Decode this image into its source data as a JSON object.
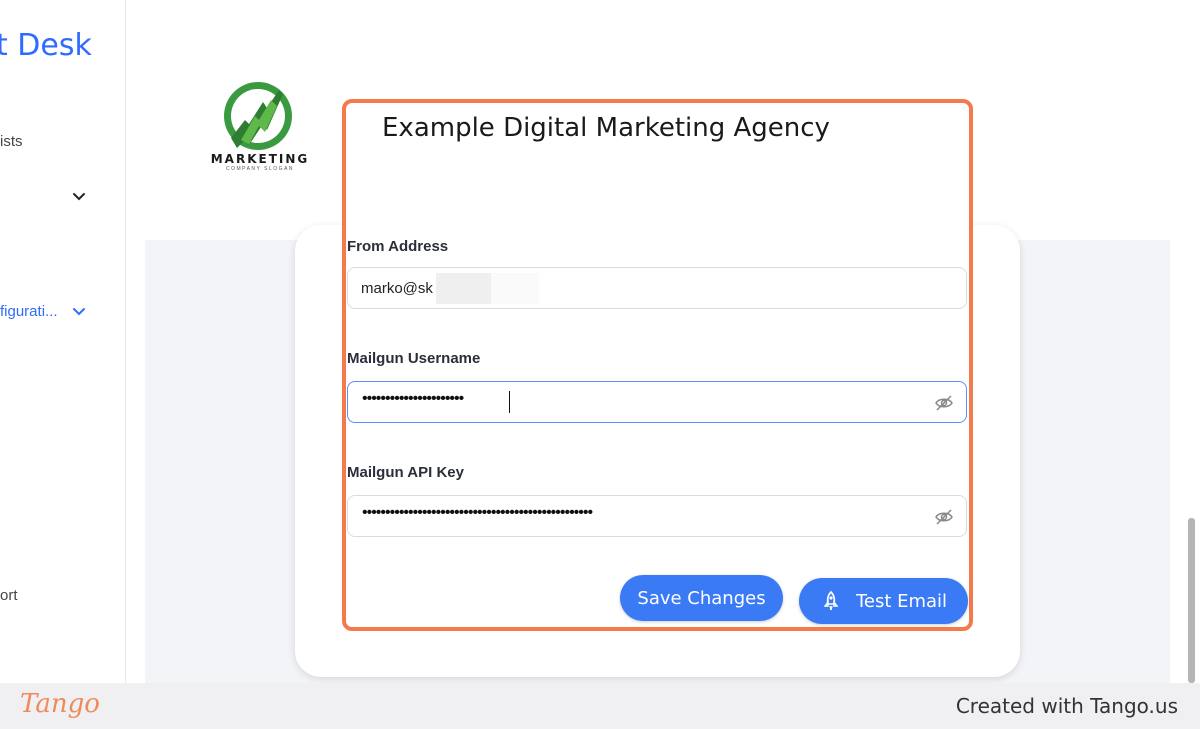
{
  "sidebar": {
    "brand_partial": "t Desk",
    "item_lists": "ists",
    "item_config": "figurati...",
    "item_support": "ort"
  },
  "org": {
    "logo_text": "MARKETING",
    "logo_subtext": "COMPANY SLOGAN",
    "name": "Example Digital Marketing Agency"
  },
  "form": {
    "from_address_label": "From Address",
    "from_address_value": "marko@sk",
    "mailgun_username_label": "Mailgun Username",
    "mailgun_username_value": "••••••••••••••••••••••",
    "mailgun_api_key_label": "Mailgun API Key",
    "mailgun_api_key_value": "••••••••••••••••••••••••••••••••••••••••••••••••••"
  },
  "buttons": {
    "save": "Save Changes",
    "test": "Test Email"
  },
  "footer": {
    "logo": "Tango",
    "created": "Created with Tango.us"
  },
  "colors": {
    "accent": "#3b7af5",
    "highlight": "#f57a4b",
    "brand": "#2f6bff"
  }
}
